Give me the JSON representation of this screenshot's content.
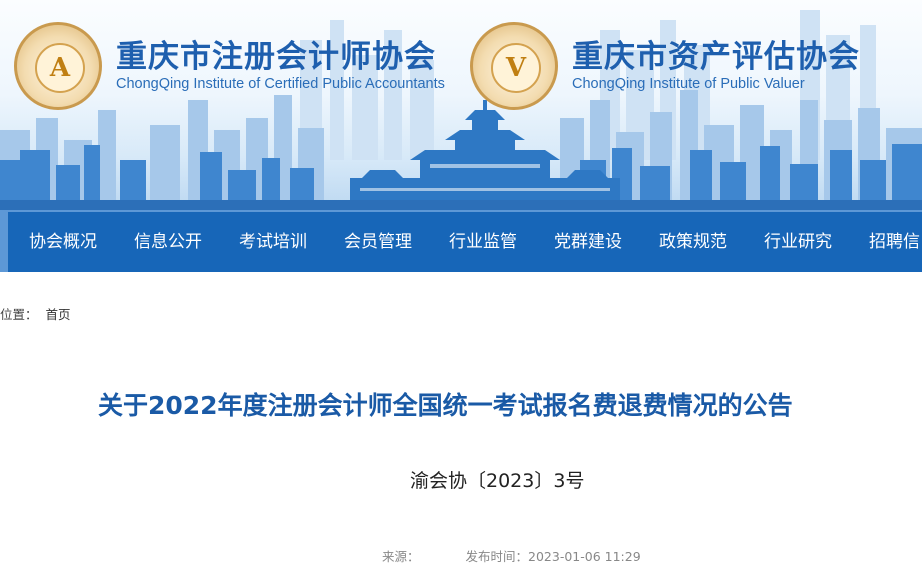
{
  "header": {
    "org1": {
      "name": "重庆市注册会计师协会",
      "name_en": "ChongQing Institute of Certified Public Accountants",
      "logo_icon": "cicpa-logo-icon",
      "logo_mark": "A"
    },
    "org2": {
      "name": "重庆市资产评估协会",
      "name_en": "ChongQing Institute of Public Valuer",
      "logo_icon": "cqpv-logo-icon",
      "logo_mark": "V"
    },
    "colors": {
      "brand_blue": "#1766b8",
      "title_blue": "#1a5aa6",
      "gold": "#c99a4e"
    }
  },
  "nav": {
    "items": [
      {
        "label": "协会概况"
      },
      {
        "label": "信息公开"
      },
      {
        "label": "考试培训"
      },
      {
        "label": "会员管理"
      },
      {
        "label": "行业监管"
      },
      {
        "label": "党群建设"
      },
      {
        "label": "政策规范"
      },
      {
        "label": "行业研究"
      },
      {
        "label": "招聘信"
      }
    ]
  },
  "breadcrumb": {
    "prefix": "位置：",
    "home": "首页"
  },
  "article": {
    "title": "关于2022年度注册会计师全国统一考试报名费退费情况的公告",
    "doc_number": "渝会协〔2023〕3号",
    "source_label": "来源：",
    "source_value": "",
    "published_label": "发布时间：",
    "published_value": "2023-01-06 11:29"
  }
}
